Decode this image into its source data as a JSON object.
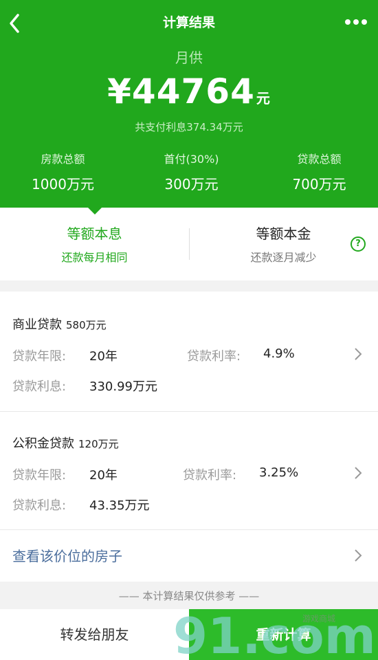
{
  "nav": {
    "title": "计算结果"
  },
  "result": {
    "monthly_label": "月供",
    "monthly_amount": "¥44764",
    "monthly_unit": "元",
    "total_interest": "共支付利息374.34万元"
  },
  "summary": [
    {
      "label": "房款总额",
      "value": "1000万元"
    },
    {
      "label": "首付(30%)",
      "value": "300万元"
    },
    {
      "label": "贷款总额",
      "value": "700万元"
    }
  ],
  "tabs": [
    {
      "title": "等额本息",
      "subtitle": "还款每月相同",
      "active": true
    },
    {
      "title": "等额本金",
      "subtitle": "还款逐月减少",
      "active": false
    }
  ],
  "loans": [
    {
      "title": "商业贷款",
      "amount": "580万元",
      "term_label": "贷款年限:",
      "term_value": "20年",
      "rate_label": "贷款利率:",
      "rate_value": "4.9%",
      "interest_label": "贷款利息:",
      "interest_value": "330.99万元"
    },
    {
      "title": "公积金贷款",
      "amount": "120万元",
      "term_label": "贷款年限:",
      "term_value": "20年",
      "rate_label": "贷款利率:",
      "rate_value": "3.25%",
      "interest_label": "贷款利息:",
      "interest_value": "43.35万元"
    }
  ],
  "link": {
    "label": "查看该价位的房子"
  },
  "disclaimer": "—— 本计算结果仅供参考 ——",
  "buttons": {
    "share": "转发给朋友",
    "recalc": "重新计算"
  },
  "watermark": {
    "text": "91.com",
    "sub": "游戏商城"
  },
  "colors": {
    "brand_green": "#21a81d",
    "button_green": "#2dbb2a",
    "link_blue": "#4a6d9c"
  },
  "icons": [
    "back-arrow-icon",
    "more-dots-icon",
    "help-circle-icon",
    "chevron-right-icon"
  ]
}
